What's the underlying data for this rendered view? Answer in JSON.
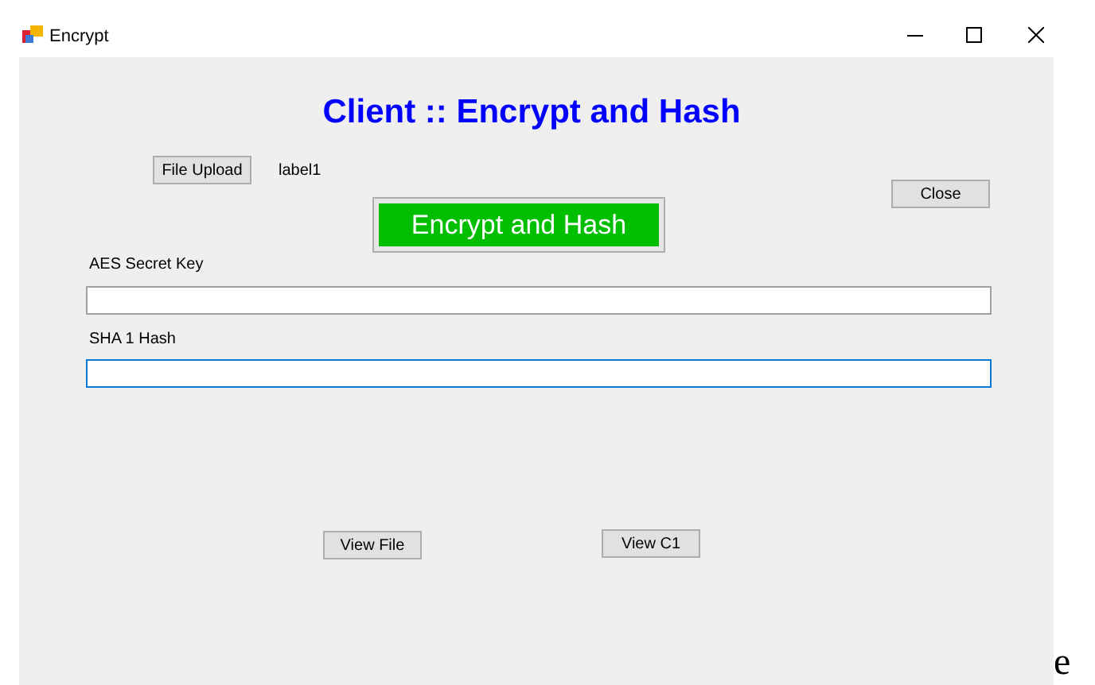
{
  "window": {
    "title": "Encrypt"
  },
  "form": {
    "heading": "Client :: Encrypt and Hash",
    "upload_button": "File Upload",
    "file_label": "label1",
    "close_button": "Close",
    "encrypt_button": "Encrypt and Hash",
    "fields": [
      {
        "label": "AES Secret Key",
        "focused": false
      },
      {
        "label": "SHA 1 Hash",
        "focused": true
      }
    ],
    "view_file_button": "View File",
    "view_c1_button": "View C1"
  },
  "stray_text": "e"
}
